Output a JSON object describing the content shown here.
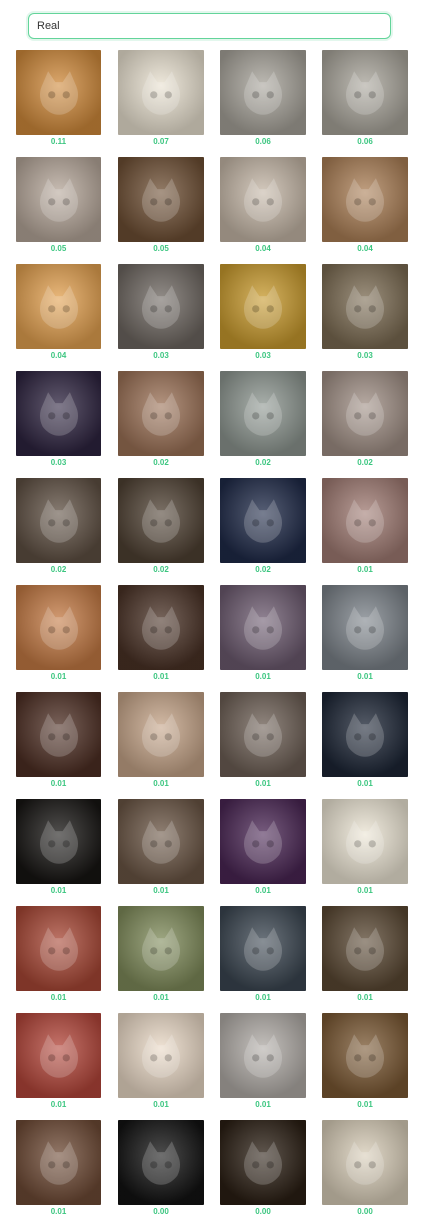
{
  "search": {
    "value": "Real",
    "placeholder": ""
  },
  "gallery": {
    "score_color": "#3cc680",
    "items": [
      {
        "score": "0.11",
        "color": "#d08a3b",
        "icon": "cat-image-icon"
      },
      {
        "score": "0.07",
        "color": "#e9e1d0",
        "icon": "cat-image-icon"
      },
      {
        "score": "0.06",
        "color": "#a7a39a",
        "icon": "cat-image-icon"
      },
      {
        "score": "0.06",
        "color": "#a9a59b",
        "icon": "cat-image-icon"
      },
      {
        "score": "0.05",
        "color": "#b6a79a",
        "icon": "cat-image-icon"
      },
      {
        "score": "0.05",
        "color": "#6e4f34",
        "icon": "cat-image-icon"
      },
      {
        "score": "0.04",
        "color": "#c5b7a7",
        "icon": "cat-image-icon"
      },
      {
        "score": "0.04",
        "color": "#ab7f56",
        "icon": "cat-image-icon"
      },
      {
        "score": "0.04",
        "color": "#e3a150",
        "icon": "cat-image-icon"
      },
      {
        "score": "0.03",
        "color": "#6e6761",
        "icon": "cat-image-icon"
      },
      {
        "score": "0.03",
        "color": "#c89a2d",
        "icon": "cat-image-icon"
      },
      {
        "score": "0.03",
        "color": "#7b6b52",
        "icon": "cat-image-icon"
      },
      {
        "score": "0.03",
        "color": "#2e2440",
        "icon": "cat-image-icon"
      },
      {
        "score": "0.02",
        "color": "#9b7156",
        "icon": "cat-image-icon"
      },
      {
        "score": "0.02",
        "color": "#8d9690",
        "icon": "cat-image-icon"
      },
      {
        "score": "0.02",
        "color": "#a08f85",
        "icon": "cat-image-icon"
      },
      {
        "score": "0.02",
        "color": "#5f5043",
        "icon": "cat-image-icon"
      },
      {
        "score": "0.02",
        "color": "#4f4133",
        "icon": "cat-image-icon"
      },
      {
        "score": "0.02",
        "color": "#1f2a48",
        "icon": "cat-image-icon"
      },
      {
        "score": "0.01",
        "color": "#a07b73",
        "icon": "cat-image-icon"
      },
      {
        "score": "0.01",
        "color": "#c47a44",
        "icon": "cat-image-icon"
      },
      {
        "score": "0.01",
        "color": "#4a3226",
        "icon": "cat-image-icon"
      },
      {
        "score": "0.01",
        "color": "#6c5a6f",
        "icon": "cat-image-icon"
      },
      {
        "score": "0.01",
        "color": "#7b8289",
        "icon": "cat-image-icon"
      },
      {
        "score": "0.01",
        "color": "#4e2f24",
        "icon": "cat-image-icon"
      },
      {
        "score": "0.01",
        "color": "#c5a488",
        "icon": "cat-image-icon"
      },
      {
        "score": "0.01",
        "color": "#6d5f55",
        "icon": "cat-image-icon"
      },
      {
        "score": "0.01",
        "color": "#1d2636",
        "icon": "cat-image-icon"
      },
      {
        "score": "0.01",
        "color": "#171513",
        "icon": "cat-image-icon"
      },
      {
        "score": "0.01",
        "color": "#6a5544",
        "icon": "cat-image-icon"
      },
      {
        "score": "0.01",
        "color": "#4a2654",
        "icon": "cat-image-icon"
      },
      {
        "score": "0.01",
        "color": "#ece5d4",
        "icon": "cat-image-icon"
      },
      {
        "score": "0.01",
        "color": "#a84735",
        "icon": "cat-image-icon"
      },
      {
        "score": "0.01",
        "color": "#7f8b5a",
        "icon": "cat-image-icon"
      },
      {
        "score": "0.01",
        "color": "#3b4651",
        "icon": "cat-image-icon"
      },
      {
        "score": "0.01",
        "color": "#5a4833",
        "icon": "cat-image-icon"
      },
      {
        "score": "0.01",
        "color": "#b4463a",
        "icon": "cat-image-icon"
      },
      {
        "score": "0.01",
        "color": "#ead9c6",
        "icon": "cat-image-icon"
      },
      {
        "score": "0.01",
        "color": "#b1aca7",
        "icon": "cat-image-icon"
      },
      {
        "score": "0.01",
        "color": "#7a5833",
        "icon": "cat-image-icon"
      },
      {
        "score": "0.01",
        "color": "#6e4a35",
        "icon": "cat-image-icon"
      },
      {
        "score": "0.00",
        "color": "#121212",
        "icon": "cat-image-icon"
      },
      {
        "score": "0.00",
        "color": "#2b1f14",
        "icon": "cat-image-icon"
      },
      {
        "score": "0.00",
        "color": "#d8cdb8",
        "icon": "cat-image-icon"
      }
    ]
  }
}
